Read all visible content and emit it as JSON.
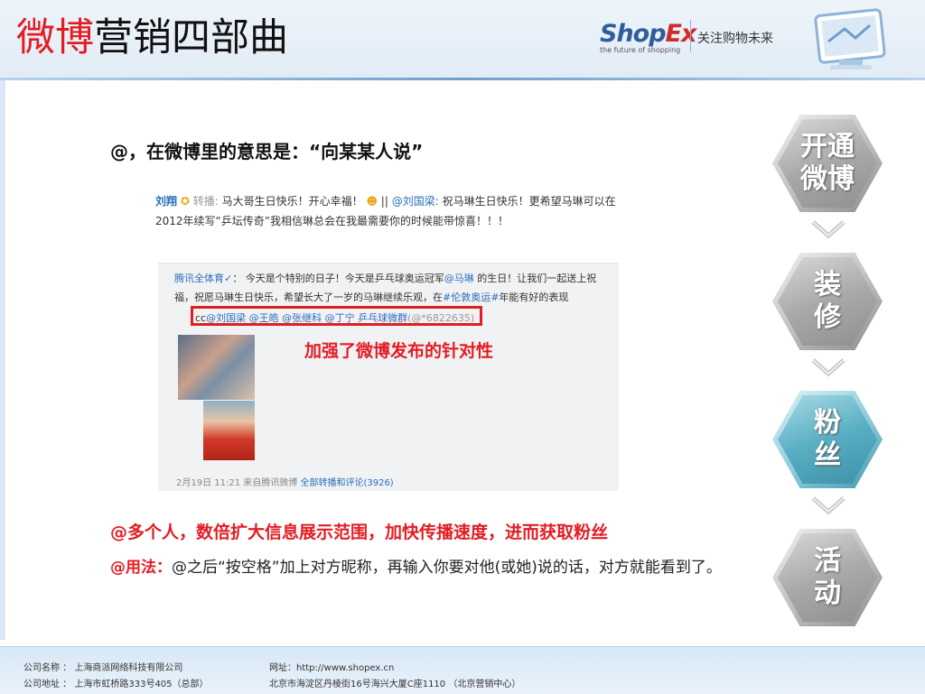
{
  "title": {
    "red": "微博",
    "black": "营销四部曲"
  },
  "logo": {
    "brand_a": "Shop",
    "brand_b": "Ex",
    "tagline": "the future of shopping",
    "slogan": "关注购物未来"
  },
  "heading": "@，在微博里的意思是：“向某某人说”",
  "weibo": {
    "author": "刘翔",
    "repost_word": "转播:",
    "text_1": "马大哥生日快乐！开心幸福！",
    "mention": "@刘国梁:",
    "text_2": "祝马琳生日快乐！更希望马琳可以在2012年续写“乒坛传奇”我相信琳总会在我最需要你的时候能带惊喜！！！",
    "repost": {
      "author": "腾讯全体育",
      "text_1": "今天是个特别的日子！今天是乒乓球奥运冠军",
      "mention_1": "@马琳",
      "text_2": "的生日！让我们一起送上祝福，祝愿马琳生日快乐，希望长大了一岁的马琳继续乐观，在",
      "topic": "#伦敦奥运#",
      "text_3": "年能有好的表现"
    },
    "cc": {
      "prefix": "cc",
      "names": "@刘国梁 @王皓 @张继科 @丁宁 乒乓球微群",
      "tail": "(@*6822635)"
    },
    "note": "加强了微博发布的针对性",
    "meta_time": "2月19日 11:21 来自腾讯微博",
    "meta_link": "全部转播和评论(3926)"
  },
  "red_line": "@多个人，数倍扩大信息展示范围，加快传播速度，进而获取粉丝",
  "usage": {
    "label": "@用法：",
    "text": "@之后“按空格”加上对方昵称，再输入你要对他(或她)说的话，对方就能看到了。"
  },
  "steps": [
    {
      "line1": "开通",
      "line2": "微博",
      "active": false
    },
    {
      "line1": "装",
      "line2": "修",
      "active": false
    },
    {
      "line1": "粉",
      "line2": "丝",
      "active": true
    },
    {
      "line1": "活",
      "line2": "动",
      "active": false
    }
  ],
  "footer": {
    "company": "公司名称 ： 上海商派网络科技有限公司",
    "address": "公司地址 ： 上海市虹桥路333号405（总部）",
    "website": "网址：http://www.shopex.cn",
    "beijing": "北京市海淀区丹棱街16号海兴大厦C座1110 （北京营销中心）"
  },
  "colors": {
    "accent_red": "#e31c24",
    "link_blue": "#2a6eba",
    "active_hex": "#58aec3"
  }
}
